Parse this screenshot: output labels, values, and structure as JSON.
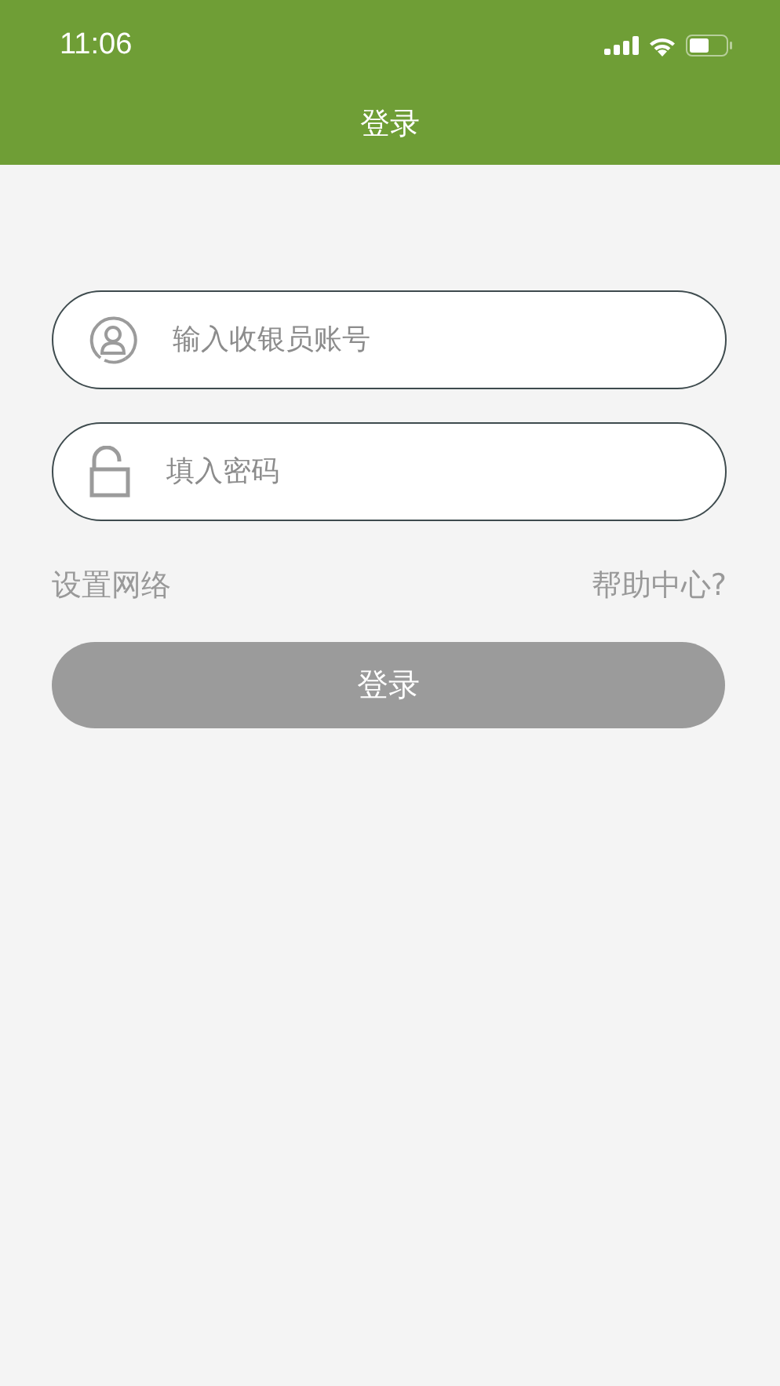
{
  "status_bar": {
    "time": "11:06"
  },
  "nav_bar": {
    "title": "登录"
  },
  "fields": [
    {
      "kind": "account",
      "placeholder": "输入收银员账号"
    },
    {
      "kind": "password",
      "placeholder": "填入密码"
    }
  ],
  "links": {
    "network": "设置网络",
    "help": "帮助中心?"
  },
  "login_button": {
    "label": "登录",
    "disabled": true
  }
}
